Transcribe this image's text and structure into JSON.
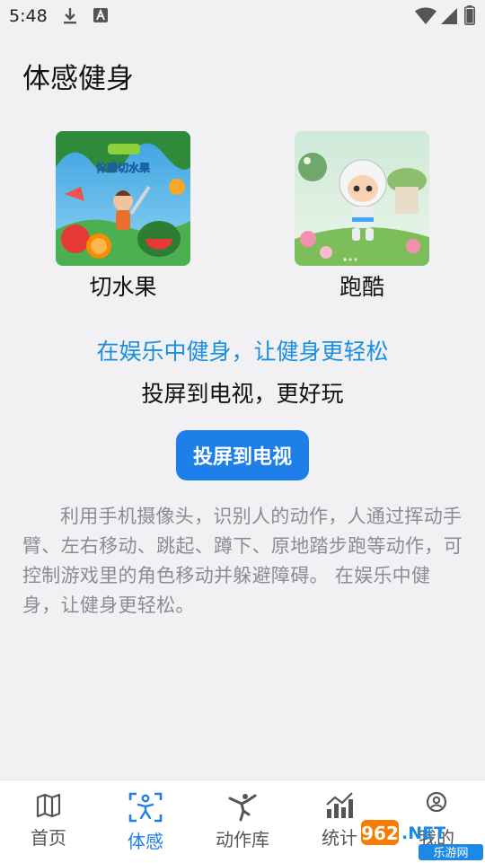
{
  "status_bar": {
    "time": "5:48"
  },
  "page": {
    "title": "体感健身"
  },
  "games": [
    {
      "name": "切水果",
      "thumb_caption": "体感切水果"
    },
    {
      "name": "跑酷"
    }
  ],
  "slogan": "在娱乐中健身，让健身更轻松",
  "subline": "投屏到电视，更好玩",
  "cast_button": "投屏到电视",
  "description": "利用手机摄像头，识别人的动作，人通过挥动手臂、左右移动、跳起、蹲下、原地踏步跑等动作，可控制游戏里的角色移动并躲避障碍。 在娱乐中健身，让健身更轻松。",
  "nav": [
    {
      "label": "首页",
      "icon": "map-icon"
    },
    {
      "label": "体感",
      "icon": "scan-person-icon",
      "active": true
    },
    {
      "label": "动作库",
      "icon": "yoga-icon"
    },
    {
      "label": "统计",
      "icon": "chart-icon"
    },
    {
      "label": "我的",
      "icon": "user-icon"
    }
  ],
  "watermark": {
    "brand": "962.NET",
    "site": "乐游网"
  },
  "colors": {
    "accent": "#1f7fe9",
    "slogan": "#1a8fe0",
    "background": "#f1f1f3"
  }
}
